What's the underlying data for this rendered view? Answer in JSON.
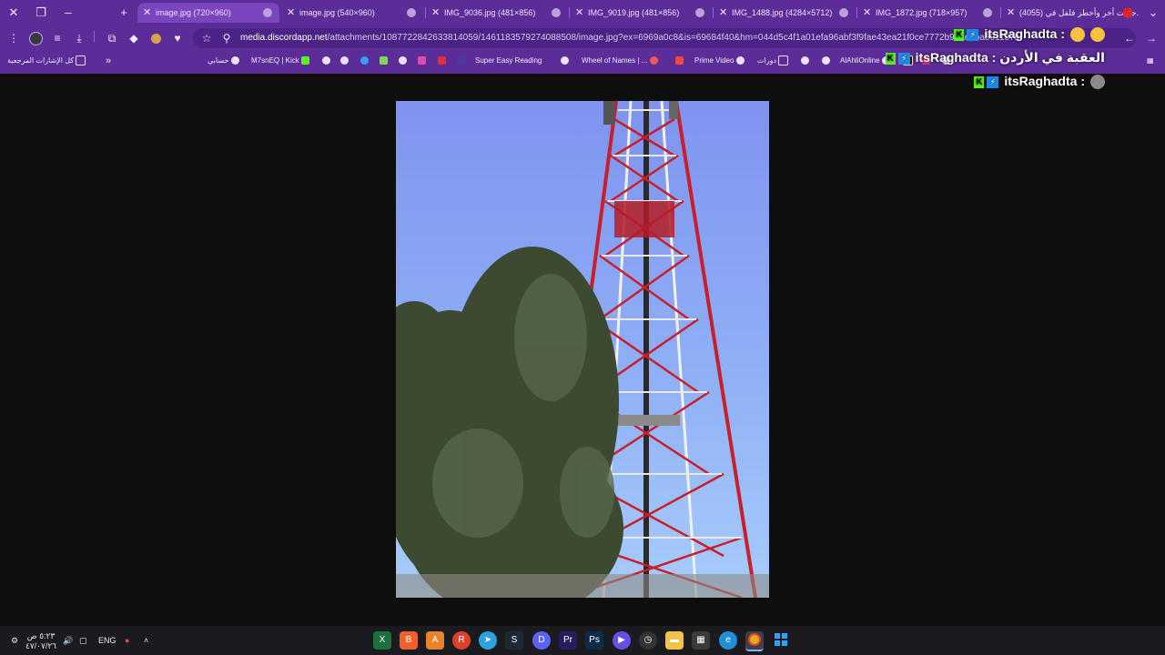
{
  "tabs": [
    {
      "title": "image.jpg (720×960)",
      "active": true
    },
    {
      "title": "image.jpg (540×960)"
    },
    {
      "title": "IMG_9036.jpg (481×856)"
    },
    {
      "title": "IMG_9019.jpg (481×856)"
    },
    {
      "title": "IMG_1488.jpg (4284×5712)"
    },
    {
      "title": "IMG_1872.jpg (718×957)"
    },
    {
      "title": "(4055) جربت أخر وأخطر فلفل في..."
    }
  ],
  "toolbar": {
    "url_host": "media.discordapp.net",
    "url_path": "/attachments/1087722842633814059/1461183579274088508/image.jpg?ex=6969a0c8&is=69684f40&hm=044d5c4f1a01efa96abf3f9fae43ea21f0ce7772b98aeeba591137b"
  },
  "bookmarks": {
    "all_label": "كل الإشارات المرجعية",
    "items": [
      "حسابي",
      "M7snEQ | Kick",
      "Super Easy Reading",
      "Wheel of Names | ...",
      "Prime Video",
      "دورات",
      "AlAhliOnline"
    ]
  },
  "chat": [
    {
      "user": "itsRaghadta :",
      "message": ""
    },
    {
      "user": "itsRaghadta :",
      "message": "العقبة في الأردن"
    },
    {
      "user": "itsRaghadta :",
      "message": ""
    }
  ],
  "taskbar": {
    "time": "٥:٢٣ ص",
    "date": "٤٧/٠٧/٢٦",
    "lang": "ENG"
  },
  "colors": {
    "chrome_purple": "#5c2c98",
    "active_tab": "#7a45bf",
    "viewer_bg": "#0e0e0e",
    "taskbar": "#1b1b1f"
  }
}
